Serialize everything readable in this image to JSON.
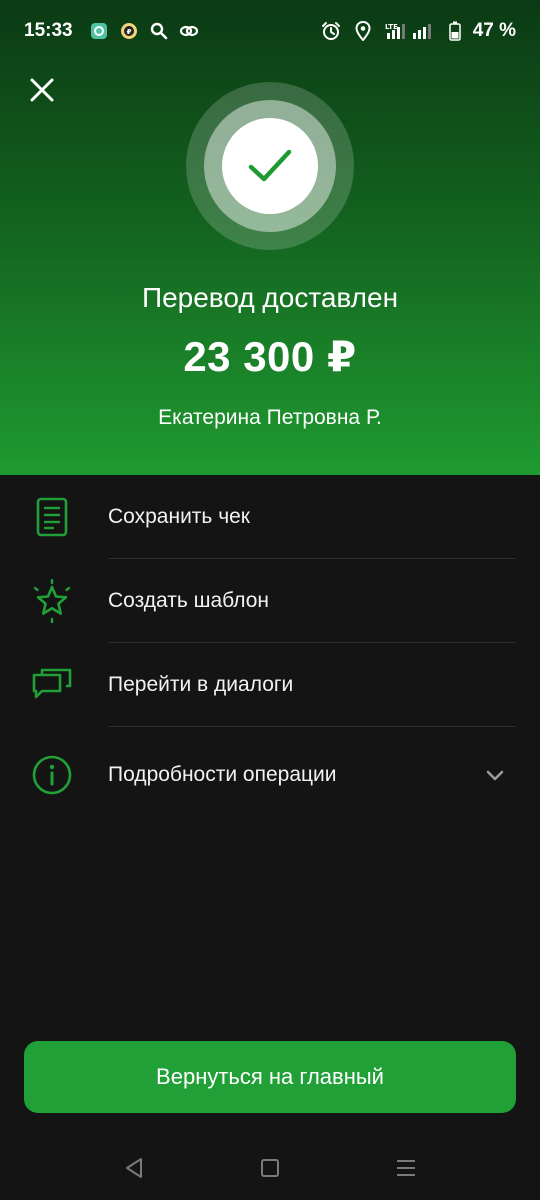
{
  "status_bar": {
    "time": "15:33",
    "battery": "47 %",
    "notification_icons": [
      "app-icon",
      "app-icon",
      "search-icon",
      "link-icon"
    ],
    "system_icons": [
      "alarm-icon",
      "location-icon",
      "signal-icon",
      "signal-icon",
      "battery-icon"
    ]
  },
  "result": {
    "title": "Перевод доставлен",
    "amount": "23 300 ₽",
    "recipient": "Екатерина Петровна Р."
  },
  "actions": [
    {
      "label": "Сохранить чек",
      "icon": "receipt-icon"
    },
    {
      "label": "Создать шаблон",
      "icon": "star-icon"
    },
    {
      "label": "Перейти в диалоги",
      "icon": "chat-icon"
    },
    {
      "label": "Подробности операции",
      "icon": "info-icon"
    }
  ],
  "primary_button": {
    "label": "Вернуться на главный"
  },
  "colors": {
    "accent": "#21a038",
    "background": "#141414",
    "hero_top": "#0b3a14",
    "hero_bottom": "#1f9a30"
  }
}
